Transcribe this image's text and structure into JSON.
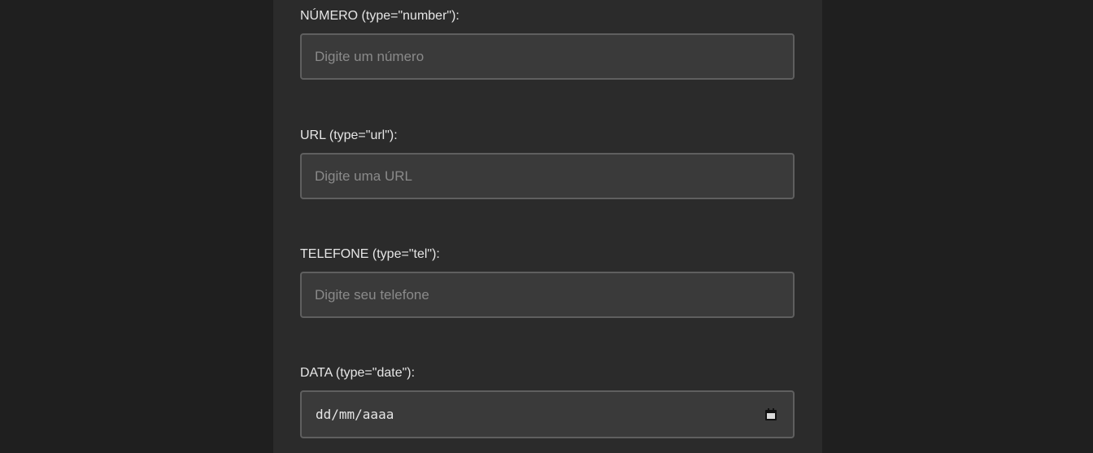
{
  "form": {
    "number": {
      "label": "NÚMERO (type=\"number\"):",
      "placeholder": "Digite um número",
      "value": ""
    },
    "url": {
      "label": "URL (type=\"url\"):",
      "placeholder": "Digite uma URL",
      "value": ""
    },
    "tel": {
      "label": "TELEFONE (type=\"tel\"):",
      "placeholder": "Digite seu telefone",
      "value": ""
    },
    "date": {
      "label": "DATA (type=\"date\"):",
      "display": "dd/mm/aaaa",
      "icon": "calendar-icon"
    }
  },
  "colors": {
    "page_background": "#1f1f1f",
    "panel_background": "#2b2b2b",
    "input_background": "#3a3a3a",
    "input_border": "#5f5f5f",
    "label_text": "#e6e6e6",
    "placeholder_text": "#8a8a8a"
  }
}
